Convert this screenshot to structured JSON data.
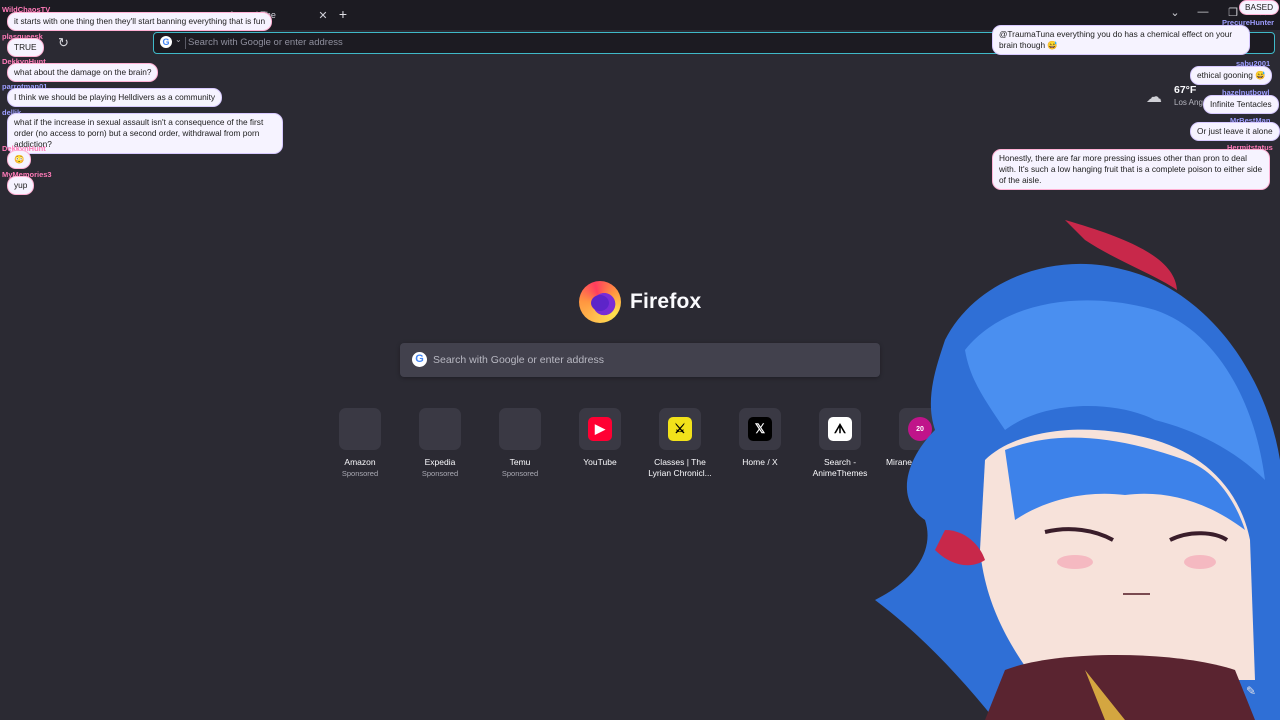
{
  "browser": {
    "tab_title": "formed The",
    "tab_close": "✕",
    "new_tab": "+",
    "window_controls": [
      "⌄",
      "—",
      "❐",
      "✕"
    ],
    "url_placeholder": "Search with Google or enter address",
    "reload_icon": "reload-icon"
  },
  "newtab": {
    "brand": "Firefox",
    "search_placeholder": "Search with Google or enter address",
    "shortcuts": [
      {
        "label": "Amazon",
        "sub": "Sponsored",
        "icon": "blank-icon",
        "color": "#3a3944",
        "glyph": ""
      },
      {
        "label": "Expedia",
        "sub": "Sponsored",
        "icon": "blank-icon",
        "color": "#3a3944",
        "glyph": ""
      },
      {
        "label": "Temu",
        "sub": "Sponsored",
        "icon": "blank-icon",
        "color": "#3a3944",
        "glyph": ""
      },
      {
        "label": "YouTube",
        "sub": "",
        "icon": "youtube-icon",
        "color": "#ff0033",
        "glyph": "▶"
      },
      {
        "label": "Classes | The Lyrian Chronicl...",
        "sub": "",
        "icon": "lyrian-icon",
        "color": "#f2e21a",
        "glyph": "⚔"
      },
      {
        "label": "Home / X",
        "sub": "",
        "icon": "x-icon",
        "color": "#000000",
        "glyph": "𝕏"
      },
      {
        "label": "Search - AnimeThemes",
        "sub": "",
        "icon": "animethemes-icon",
        "color": "#ffffff",
        "glyph": "ᗑ"
      },
      {
        "label": "Mirane Expedition 2 |...",
        "sub": "",
        "icon": "mirane-icon",
        "color": "#c0148a",
        "glyph": "20"
      }
    ]
  },
  "weather": {
    "temperature": "67°F",
    "location": "Los Ang"
  },
  "chat_left": [
    {
      "user": "WildChaosTV",
      "message": "it starts with one thing then they'll start banning everything that is fun",
      "style": "pink"
    },
    {
      "user": "plasqueesk",
      "message": "TRUE",
      "style": "pink"
    },
    {
      "user": "DekkynHunt",
      "message": "what about the damage on the brain?",
      "style": "pink"
    },
    {
      "user": "parrotman01",
      "message": "I think we should be playing Helldivers as a community",
      "style": "blue"
    },
    {
      "user": "dellik",
      "message": "what if the increase in sexual assault isn't a consequence of the first order (no access to porn) but a second order, withdrawal from porn addiction?",
      "style": "blue"
    },
    {
      "user": "DekkynHunt",
      "message": "😳",
      "style": "pink"
    },
    {
      "user": "MyMemories3",
      "message": "yup",
      "style": "pink"
    }
  ],
  "chat_right": [
    {
      "user": "BASED",
      "message": "",
      "style": "pink"
    },
    {
      "user": "PrecureHunter",
      "message": "@TraumaTuna everything you do has a chemical effect on your brain though 😅",
      "style": "blue"
    },
    {
      "user": "sabu2001",
      "message": "ethical gooning 😅",
      "style": "blue"
    },
    {
      "user": "hazelnutbowl",
      "message": "Infinite Tentacles",
      "style": "blue"
    },
    {
      "user": "MrBestMan",
      "message": "Or just leave it alone",
      "style": "blue"
    },
    {
      "user": "Hermitstatus",
      "message": "Honestly, there are far more pressing issues other than pron to deal with. It's such a low hanging fruit that is a complete poison to either side of the aisle.",
      "style": "pink"
    }
  ]
}
